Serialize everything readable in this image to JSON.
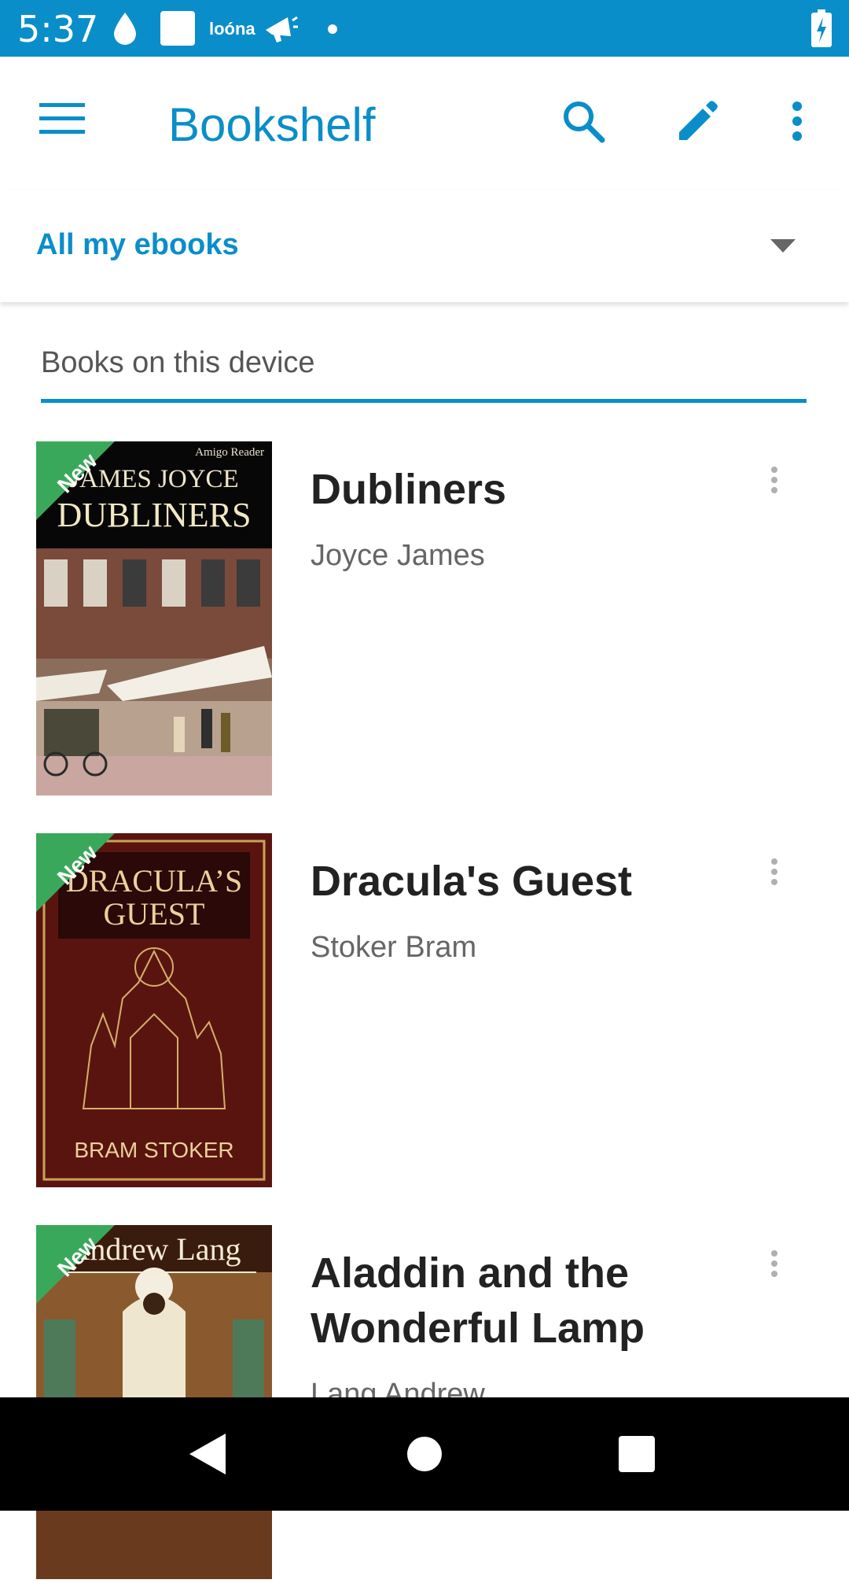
{
  "status_bar": {
    "time": "5:37",
    "carrier_text": "loóna",
    "icons": [
      "water-drop-icon",
      "square-icon",
      "megaphone-icon",
      "dot-icon",
      "battery-charging-icon"
    ]
  },
  "app_bar": {
    "title": "Bookshelf",
    "icons": [
      "menu-icon",
      "search-icon",
      "edit-icon",
      "more-vert-icon"
    ]
  },
  "filter": {
    "selected": "All my ebooks"
  },
  "tab": {
    "label": "Books on this device"
  },
  "books": [
    {
      "title": "Dubliners",
      "author": "Joyce James",
      "badge": "New",
      "cover": {
        "publisher": "Amigo Reader",
        "author_line": "JAMES JOYCE",
        "title_line": "DUBLINERS"
      }
    },
    {
      "title": "Dracula's Guest",
      "author": "Stoker Bram",
      "badge": "New",
      "cover": {
        "title_line_1": "DRACULA’S",
        "title_line_2": "GUEST",
        "author_line": "BRAM STOKER"
      }
    },
    {
      "title": "Aladdin and the Wonderful Lamp",
      "author": "Lang Andrew",
      "badge": "New",
      "cover": {
        "author_line": "Andrew Lang"
      }
    }
  ],
  "colors": {
    "accent": "#0a8ec9",
    "badge_green": "#3aa85a",
    "title_text": "#222222",
    "secondary_text": "#666666"
  },
  "nav_bar": {
    "icons": [
      "back-icon",
      "home-icon",
      "recents-icon"
    ]
  }
}
